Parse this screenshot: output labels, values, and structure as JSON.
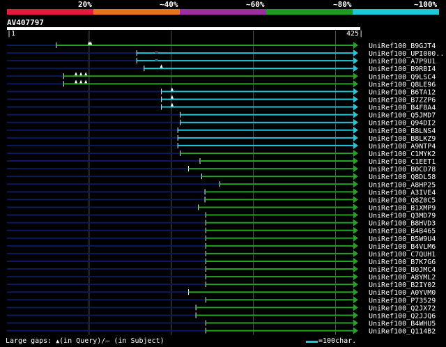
{
  "legend": {
    "labels": [
      "20%",
      "~40%",
      "~60%",
      "~80%",
      "~100%"
    ],
    "colors": [
      "#e8173c",
      "#e8731e",
      "#9c2e9e",
      "#1f9c1f",
      "#1fc8d8"
    ]
  },
  "query": {
    "id": "AV407797",
    "start": "1",
    "end": "425",
    "length": 425
  },
  "colors": {
    "green": "#22a322",
    "cyan": "#22c6d6",
    "navy": "#0b1a5c",
    "grid": "#555555"
  },
  "hits": [
    {
      "name": "UniRef100_B9GJT4",
      "color": "green",
      "start": 60,
      "gaps_q": [
        100,
        102
      ],
      "gaps_s": []
    },
    {
      "name": "UniRef100_UPI000..",
      "color": "cyan",
      "start": 158,
      "gaps_q": [],
      "gaps_s": [
        182
      ]
    },
    {
      "name": "UniRef100_A7P9U1",
      "color": "cyan",
      "start": 158,
      "gaps_q": [],
      "gaps_s": [
        182
      ]
    },
    {
      "name": "UniRef100_B9RBI4",
      "color": "cyan",
      "start": 167,
      "gaps_q": [
        188
      ],
      "gaps_s": []
    },
    {
      "name": "UniRef100_Q9LSC4",
      "color": "green",
      "start": 69,
      "gaps_q": [
        84,
        90,
        96
      ],
      "gaps_s": []
    },
    {
      "name": "UniRef100_Q8LE96",
      "color": "green",
      "start": 69,
      "gaps_q": [
        84,
        90,
        96
      ],
      "gaps_s": []
    },
    {
      "name": "UniRef100_B6TA12",
      "color": "cyan",
      "start": 188,
      "gaps_q": [
        201
      ],
      "gaps_s": []
    },
    {
      "name": "UniRef100_B7ZZP6",
      "color": "cyan",
      "start": 188,
      "gaps_q": [
        201
      ],
      "gaps_s": []
    },
    {
      "name": "UniRef100_B4F8A4",
      "color": "cyan",
      "start": 188,
      "gaps_q": [
        201
      ],
      "gaps_s": []
    },
    {
      "name": "UniRef100_Q5JMD7",
      "color": "cyan",
      "start": 211,
      "gaps_q": [],
      "gaps_s": []
    },
    {
      "name": "UniRef100_Q94DI2",
      "color": "cyan",
      "start": 211,
      "gaps_q": [],
      "gaps_s": []
    },
    {
      "name": "UniRef100_B8LNS4",
      "color": "cyan",
      "start": 208,
      "gaps_q": [],
      "gaps_s": []
    },
    {
      "name": "UniRef100_B8LKZ9",
      "color": "cyan",
      "start": 208,
      "gaps_q": [],
      "gaps_s": []
    },
    {
      "name": "UniRef100_A9NTP4",
      "color": "cyan",
      "start": 208,
      "gaps_q": [],
      "gaps_s": []
    },
    {
      "name": "UniRef100_C1MYK2",
      "color": "green",
      "start": 211,
      "gaps_q": [],
      "gaps_s": []
    },
    {
      "name": "UniRef100_C1EET1",
      "color": "green",
      "start": 235,
      "gaps_q": [],
      "gaps_s": []
    },
    {
      "name": "UniRef100_B0CD78",
      "color": "green",
      "start": 221,
      "gaps_q": [],
      "gaps_s": []
    },
    {
      "name": "UniRef100_Q8DL58",
      "color": "green",
      "start": 237,
      "gaps_q": [],
      "gaps_s": []
    },
    {
      "name": "UniRef100_A8HP25",
      "color": "green",
      "start": 259,
      "gaps_q": [],
      "gaps_s": []
    },
    {
      "name": "UniRef100_A3IVE4",
      "color": "green",
      "start": 241,
      "gaps_q": [],
      "gaps_s": []
    },
    {
      "name": "UniRef100_Q8Z0C5",
      "color": "green",
      "start": 241,
      "gaps_q": [],
      "gaps_s": []
    },
    {
      "name": "UniRef100_B1XMP9",
      "color": "green",
      "start": 233,
      "gaps_q": [],
      "gaps_s": []
    },
    {
      "name": "UniRef100_Q3MD79",
      "color": "green",
      "start": 242,
      "gaps_q": [],
      "gaps_s": []
    },
    {
      "name": "UniRef100_B8HVD3",
      "color": "green",
      "start": 242,
      "gaps_q": [],
      "gaps_s": []
    },
    {
      "name": "UniRef100_B4B465",
      "color": "green",
      "start": 242,
      "gaps_q": [],
      "gaps_s": []
    },
    {
      "name": "UniRef100_B5W9U4",
      "color": "green",
      "start": 242,
      "gaps_q": [],
      "gaps_s": []
    },
    {
      "name": "UniRef100_B4VLM6",
      "color": "green",
      "start": 242,
      "gaps_q": [],
      "gaps_s": []
    },
    {
      "name": "UniRef100_C7QUH1",
      "color": "green",
      "start": 242,
      "gaps_q": [],
      "gaps_s": []
    },
    {
      "name": "UniRef100_B7K7G6",
      "color": "green",
      "start": 242,
      "gaps_q": [],
      "gaps_s": []
    },
    {
      "name": "UniRef100_B0JMC4",
      "color": "green",
      "start": 242,
      "gaps_q": [],
      "gaps_s": []
    },
    {
      "name": "UniRef100_A8YML2",
      "color": "green",
      "start": 242,
      "gaps_q": [],
      "gaps_s": []
    },
    {
      "name": "UniRef100_B2IY02",
      "color": "green",
      "start": 242,
      "gaps_q": [],
      "gaps_s": []
    },
    {
      "name": "UniRef100_A0YVM0",
      "color": "green",
      "start": 221,
      "gaps_q": [],
      "gaps_s": []
    },
    {
      "name": "UniRef100_P73529",
      "color": "green",
      "start": 242,
      "gaps_q": [],
      "gaps_s": []
    },
    {
      "name": "UniRef100_Q2JX72",
      "color": "green",
      "start": 230,
      "gaps_q": [],
      "gaps_s": []
    },
    {
      "name": "UniRef100_Q2JJQ6",
      "color": "green",
      "start": 230,
      "gaps_q": [],
      "gaps_s": []
    },
    {
      "name": "UniRef100_B4WHU5",
      "color": "green",
      "start": 242,
      "gaps_q": [],
      "gaps_s": []
    },
    {
      "name": "UniRef100_Q114B2",
      "color": "green",
      "start": 242,
      "gaps_q": [],
      "gaps_s": []
    }
  ],
  "footer": {
    "gaps_prefix": "Large gaps:",
    "query_gap_glyph": "▲",
    "gaps_middle": "(in Query)/",
    "subject_gap_glyph": "–",
    "gaps_suffix": " (in Subject)",
    "scale_text": "=100char."
  }
}
